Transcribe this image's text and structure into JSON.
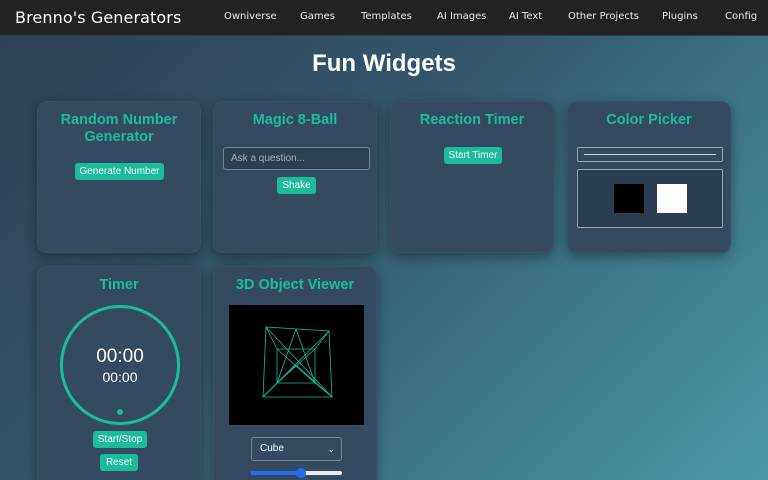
{
  "navbar": {
    "brand": "Brenno's Generators",
    "links": [
      "Owniverse",
      "Games",
      "Templates",
      "AI Images",
      "AI Text",
      "Other Projects",
      "Plugins",
      "Config"
    ]
  },
  "page": {
    "title": "Fun Widgets"
  },
  "widgets": {
    "random_number": {
      "title": "Random Number Generator",
      "button": "Generate Number"
    },
    "magic8": {
      "title": "Magic 8-Ball",
      "placeholder": "Ask a question...",
      "button": "Shake"
    },
    "reaction": {
      "title": "Reaction Timer",
      "button": "Start Timer"
    },
    "color_picker": {
      "title": "Color Picker",
      "swatch_left": "#000000",
      "swatch_right": "#ffffff"
    },
    "timer": {
      "title": "Timer",
      "display_main": "00:00",
      "display_sub": "00:00",
      "start_stop": "Start/Stop",
      "reset": "Reset"
    },
    "viewer3d": {
      "title": "3D Object Viewer",
      "shape": "Cube",
      "options": [
        "Cube"
      ],
      "zoom": 0.55
    }
  },
  "colors": {
    "accent": "#1abc9c",
    "card": "#344a63",
    "nav": "#202224"
  }
}
